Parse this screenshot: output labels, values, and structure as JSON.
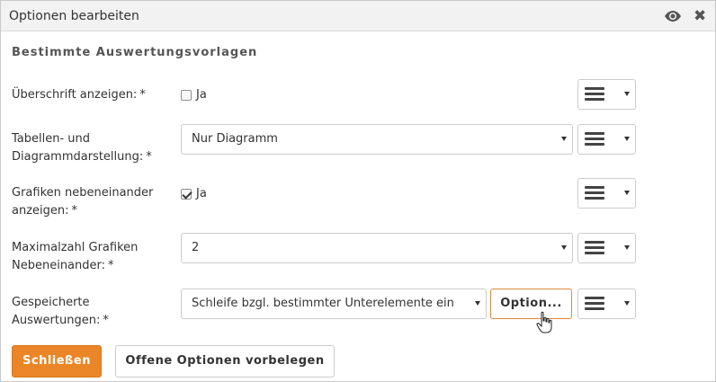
{
  "dialog": {
    "title": "Optionen bearbeiten",
    "icons": {
      "view": "eye-icon",
      "close": "close-icon"
    }
  },
  "section": {
    "title": "Bestimmte Auswertungsvorlagen"
  },
  "fields": [
    {
      "label": "Überschrift anzeigen:",
      "required_mark": "*",
      "control": "checkbox",
      "checked": false,
      "checkbox_label": "Ja"
    },
    {
      "label_line1": "Tabellen- und",
      "label_line2": "Diagrammdarstellung:",
      "required_mark": "*",
      "control": "select",
      "value": "Nur Diagramm"
    },
    {
      "label_line1": "Grafiken nebeneinander",
      "label_line2": "anzeigen:",
      "required_mark": "*",
      "control": "checkbox",
      "checked": true,
      "checkbox_label": "Ja"
    },
    {
      "label_line1": "Maximalzahl Grafiken",
      "label_line2": "Nebeneinander:",
      "required_mark": "*",
      "control": "select",
      "value": "2"
    },
    {
      "label_line1": "Gespeicherte",
      "label_line2": "Auswertungen:",
      "required_mark": "*",
      "control": "select",
      "value": "Schleife bzgl. bestimmter Unterelemente ein",
      "option_button": "Option..."
    }
  ],
  "footer": {
    "close_label": "Schließen",
    "prefill_label": "Offene Optionen vorbelegen"
  },
  "colors": {
    "accent": "#ea8628",
    "accent_border": "#e08a3c",
    "titlebar_bg": "#f2f2f2"
  }
}
